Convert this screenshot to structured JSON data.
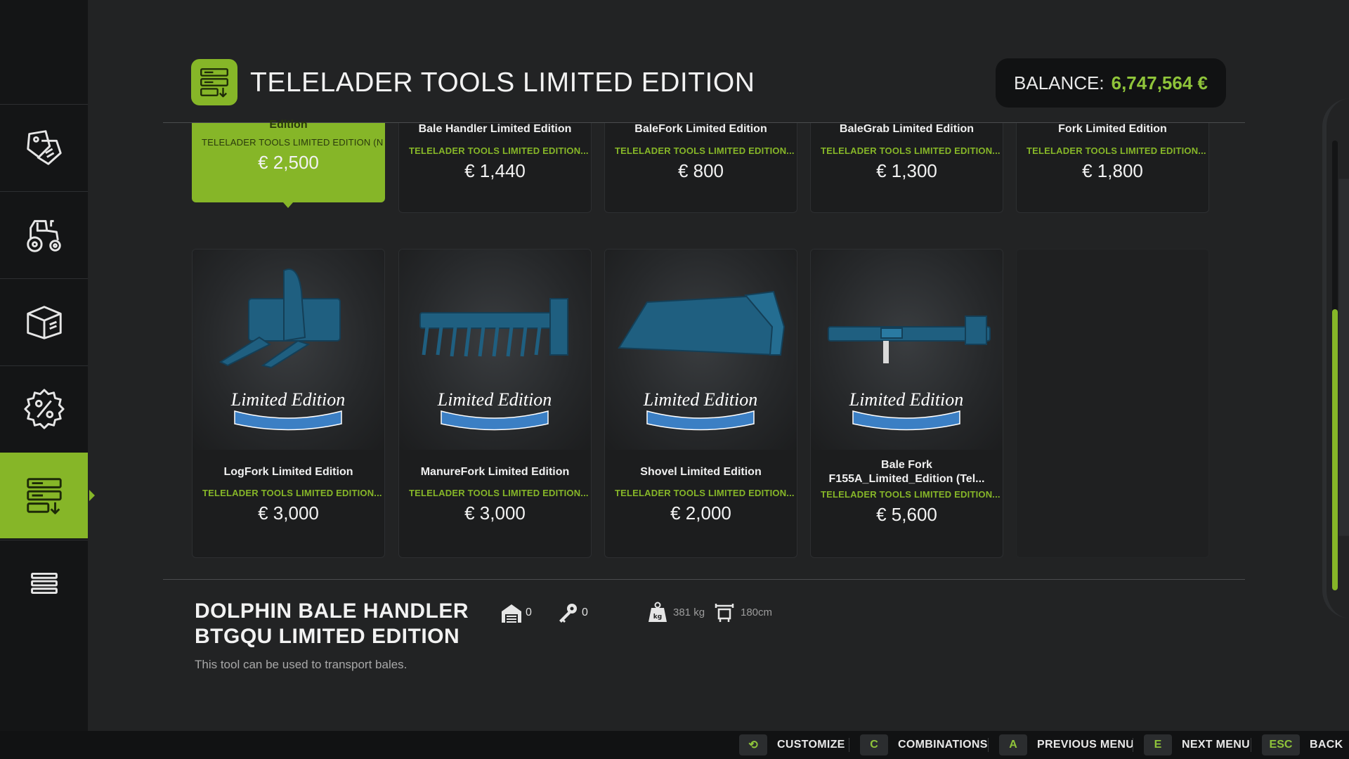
{
  "header": {
    "title": "TELELADER TOOLS LIMITED EDITION",
    "icon": "shop-tools-icon",
    "balance_label": "BALANCE:",
    "balance_value": "6,747,564 €"
  },
  "sidebar": {
    "items": [
      {
        "name": "sale-tag-icon"
      },
      {
        "name": "tractor-icon"
      },
      {
        "name": "box-icon"
      },
      {
        "name": "percent-badge-icon"
      },
      {
        "name": "shop-tools-icon",
        "active": true
      },
      {
        "name": "list-icon"
      }
    ]
  },
  "top_row": [
    {
      "name": "Edition",
      "category": "TELELADER TOOLS LIMITED EDITION (N",
      "price": "€ 2,500",
      "selected": true
    },
    {
      "name": "Bale Handler Limited Edition",
      "category": "TELELADER TOOLS LIMITED EDITION...",
      "price": "€ 1,440"
    },
    {
      "name": "BaleFork Limited Edition",
      "category": "TELELADER TOOLS LIMITED EDITION...",
      "price": "€ 800"
    },
    {
      "name": "BaleGrab Limited Edition",
      "category": "TELELADER TOOLS LIMITED EDITION...",
      "price": "€ 1,300"
    },
    {
      "name": "Fork Limited Edition",
      "category": "TELELADER TOOLS LIMITED EDITION...",
      "price": "€ 1,800"
    }
  ],
  "cards": [
    {
      "name": "LogFork Limited Edition",
      "category": "TELELADER TOOLS LIMITED EDITION...",
      "price": "€ 3,000",
      "badge": "Limited Edition"
    },
    {
      "name": "ManureFork Limited Edition",
      "category": "TELELADER TOOLS LIMITED EDITION...",
      "price": "€ 3,000",
      "badge": "Limited Edition"
    },
    {
      "name": "Shovel Limited Edition",
      "category": "TELELADER TOOLS LIMITED EDITION...",
      "price": "€ 2,000",
      "badge": "Limited Edition"
    },
    {
      "name": "Bale Fork F155A_Limited_Edition (Tel...",
      "name_line1": "Bale Fork",
      "name_line2": "F155A_Limited_Edition (Tel...",
      "category": "TELELADER TOOLS LIMITED EDITION...",
      "price": "€ 5,600",
      "badge": "Limited Edition"
    }
  ],
  "detail": {
    "title_line1": "DOLPHIN BALE HANDLER",
    "title_line2": "BTGQU LIMITED EDITION",
    "description": "This tool can be used to transport bales.",
    "owned": "0",
    "leased": "0",
    "weight": "381 kg",
    "width": "180cm"
  },
  "footer": {
    "buttons": [
      {
        "key": "⟲",
        "label": "CUSTOMIZE"
      },
      {
        "key": "C",
        "label": "COMBINATIONS"
      },
      {
        "key": "A",
        "label": "PREVIOUS MENU"
      },
      {
        "key": "E",
        "label": "NEXT MENU"
      },
      {
        "key": "ESC",
        "label": "BACK"
      }
    ]
  },
  "colors": {
    "accent": "#86b628",
    "balance": "#8fc43a",
    "background": "#222324",
    "sidebar": "#141516"
  }
}
